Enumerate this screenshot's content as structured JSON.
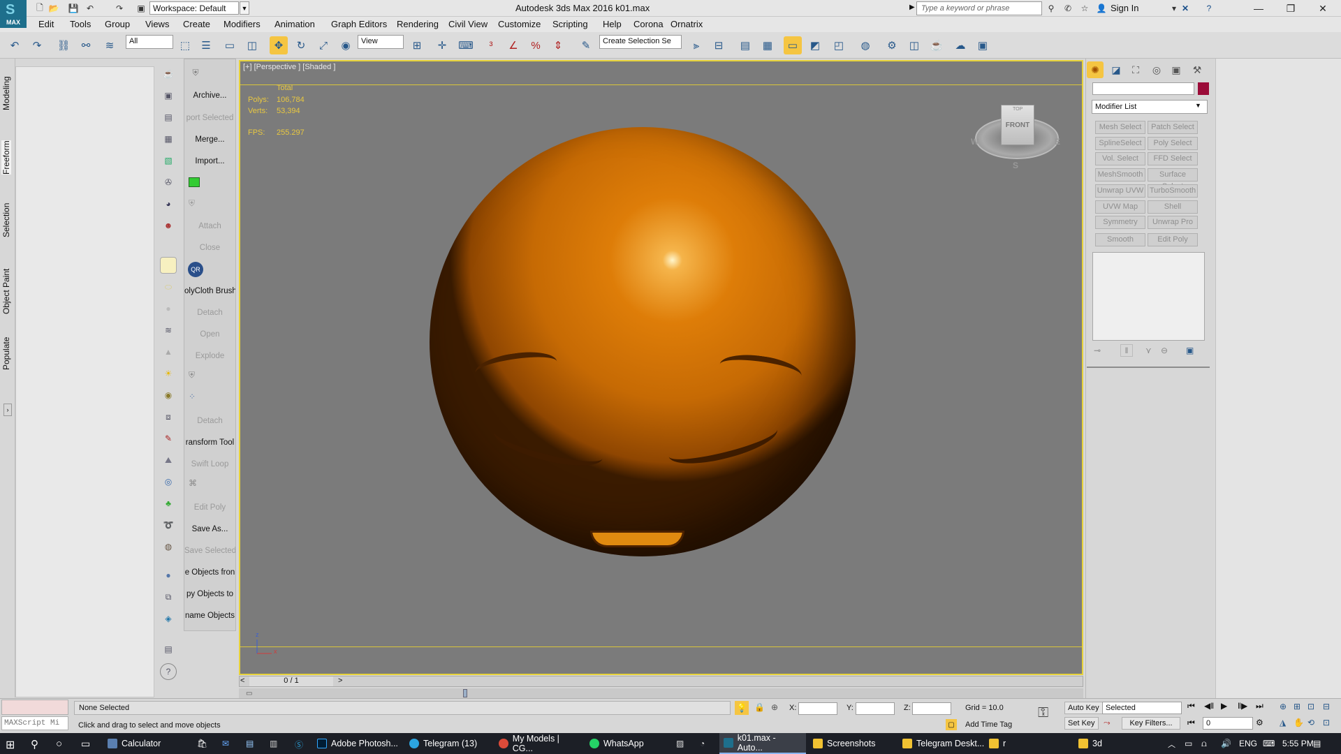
{
  "titlebar": {
    "workspace": "Workspace: Default",
    "window_title": "Autodesk 3ds Max 2016     k01.max",
    "search_placeholder": "Type a keyword or phrase",
    "signin": "Sign In",
    "logo": "MAX"
  },
  "menus": [
    "Edit",
    "Tools",
    "Group",
    "Views",
    "Create",
    "Modifiers",
    "Animation",
    "Graph Editors",
    "Rendering",
    "Civil View",
    "Customize",
    "Scripting",
    "Help",
    "Corona",
    "Ornatrix"
  ],
  "toolbar": {
    "filter": "All",
    "refcoord": "View",
    "selection_set": "Create Selection Se"
  },
  "ribbon_tabs": [
    "Modeling",
    "Freeform",
    "Selection",
    "Object Paint",
    "Populate"
  ],
  "command_column": [
    {
      "label": "Archive...",
      "disabled": false
    },
    {
      "label": "port Selected",
      "disabled": true
    },
    {
      "label": "Merge...",
      "disabled": false
    },
    {
      "label": "Import...",
      "disabled": false
    },
    {
      "label": "Attach",
      "disabled": true
    },
    {
      "label": "Close",
      "disabled": true
    },
    {
      "label": "olyCloth Brush",
      "disabled": false
    },
    {
      "label": "Detach",
      "disabled": true
    },
    {
      "label": "Open",
      "disabled": true
    },
    {
      "label": "Explode",
      "disabled": true
    },
    {
      "label": "Detach",
      "disabled": true
    },
    {
      "label": "ransform Tool",
      "disabled": false
    },
    {
      "label": "Swift Loop",
      "disabled": true
    },
    {
      "label": "Edit Poly",
      "disabled": true
    },
    {
      "label": "Save As...",
      "disabled": false
    },
    {
      "label": "Save Selected",
      "disabled": true
    },
    {
      "label": "e Objects fron",
      "disabled": false
    },
    {
      "label": "py Objects to",
      "disabled": false
    },
    {
      "label": "name Objects",
      "disabled": false
    }
  ],
  "viewport": {
    "label": "[+] [Perspective ] [Shaded ]",
    "stats_header": "Total",
    "polys_label": "Polys:",
    "polys": "106,784",
    "verts_label": "Verts:",
    "verts": "53,394",
    "fps_label": "FPS:",
    "fps": "255.297",
    "cube_face": "FRONT",
    "cube_top": "TOP",
    "compass_s": "S",
    "compass_w": "W",
    "compass_e": "E",
    "axis_z": "z",
    "axis_x": "x"
  },
  "timeline": {
    "frame": "0 / 1",
    "prev": "<",
    "next": ">"
  },
  "command_panel": {
    "modifier_list": "Modifier List",
    "accent_color": "#9b0c39",
    "modifiers": [
      "Mesh Select",
      "Patch Select",
      "SplineSelect",
      "Poly Select",
      "Vol. Select",
      "FFD Select",
      "MeshSmooth",
      "Surface Select",
      "Unwrap UVW",
      "TurboSmooth",
      "UVW Map",
      "Shell",
      "Symmetry",
      "Unwrap Pro",
      "Smooth",
      "Edit Poly"
    ]
  },
  "status": {
    "maxscript": "MAXScript Mi",
    "selection": "None Selected",
    "prompt": "Click and drag to select and move objects",
    "x_label": "X:",
    "y_label": "Y:",
    "z_label": "Z:",
    "grid": "Grid = 10.0",
    "add_time_tag": "Add Time Tag",
    "auto_key": "Auto Key",
    "set_key": "Set Key",
    "key_mode": "Selected",
    "key_filters": "Key Filters...",
    "frame_field": "0"
  },
  "taskbar": {
    "items": [
      "Calculator",
      "Adobe Photosh...",
      "Telegram (13)",
      "My Models | CG...",
      "WhatsApp",
      "k01.max - Auto...",
      "Screenshots",
      "Telegram Deskt...",
      "r",
      "3d"
    ],
    "lang": "ENG",
    "time": "5:55 PM"
  }
}
